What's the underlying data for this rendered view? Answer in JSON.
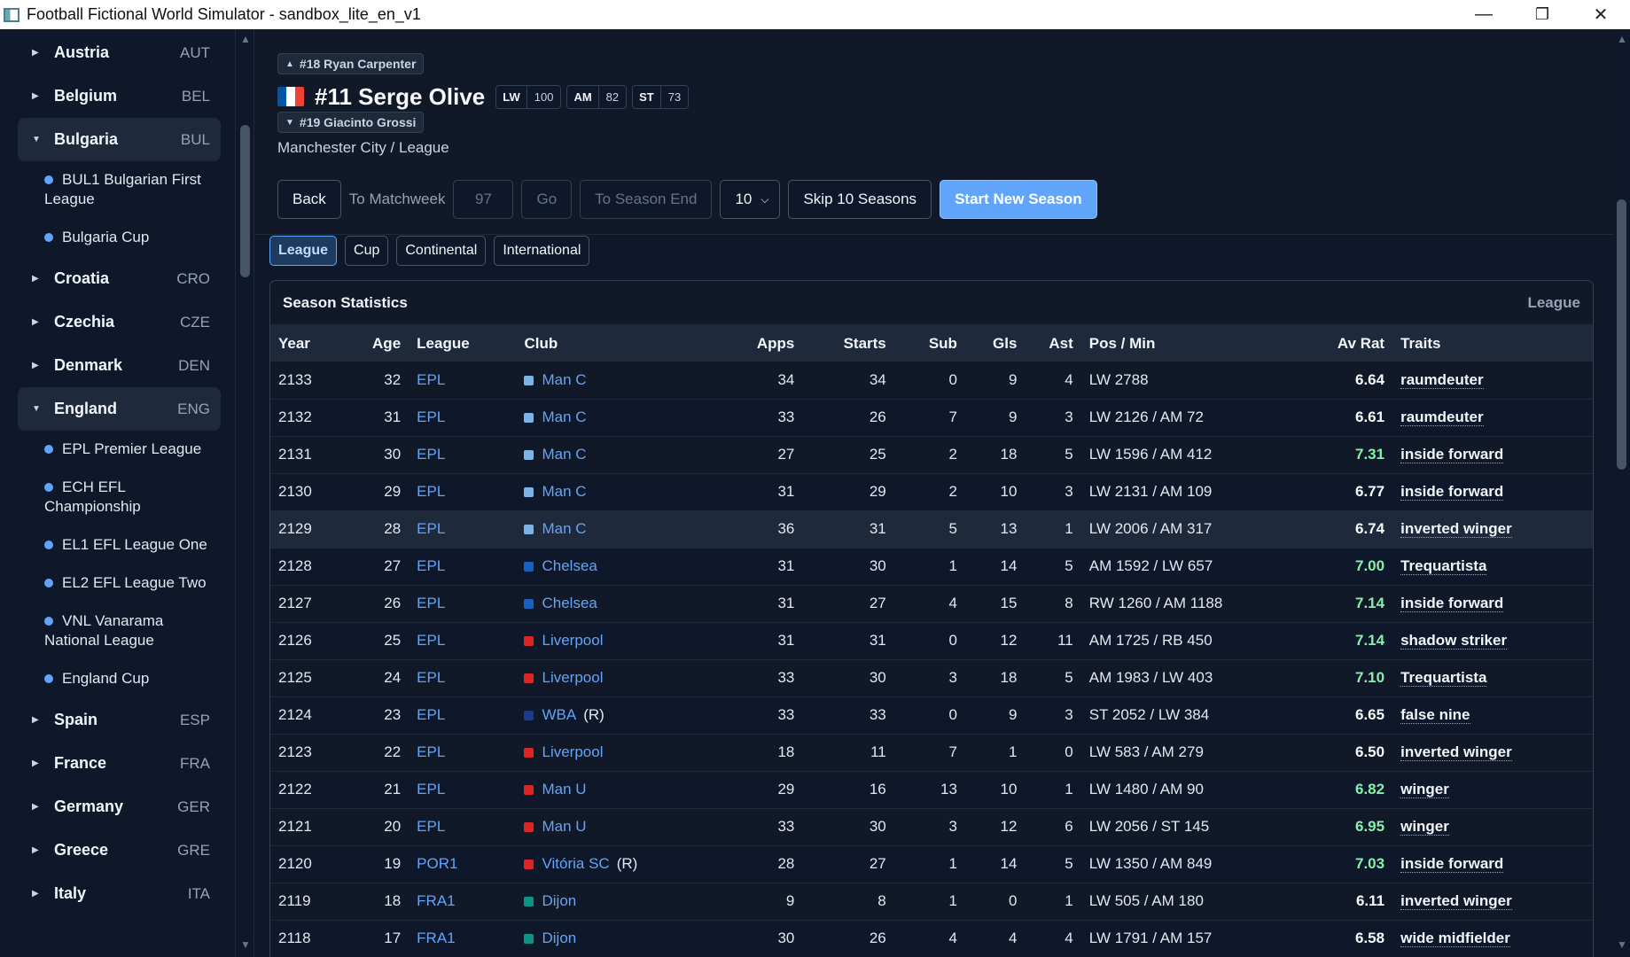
{
  "window": {
    "title": "Football Fictional World Simulator - sandbox_lite_en_v1",
    "minimize": "—",
    "maximize": "❐",
    "close": "✕"
  },
  "sidebar": {
    "items": [
      {
        "type": "country",
        "name": "Austria",
        "code": "AUT",
        "open": false
      },
      {
        "type": "country",
        "name": "Belgium",
        "code": "BEL",
        "open": false
      },
      {
        "type": "country",
        "name": "Bulgaria",
        "code": "BUL",
        "open": true
      },
      {
        "type": "comp",
        "name": "BUL1 Bulgarian First League"
      },
      {
        "type": "comp",
        "name": "Bulgaria Cup"
      },
      {
        "type": "country",
        "name": "Croatia",
        "code": "CRO",
        "open": false
      },
      {
        "type": "country",
        "name": "Czechia",
        "code": "CZE",
        "open": false
      },
      {
        "type": "country",
        "name": "Denmark",
        "code": "DEN",
        "open": false
      },
      {
        "type": "country",
        "name": "England",
        "code": "ENG",
        "open": true
      },
      {
        "type": "comp",
        "name": "EPL Premier League"
      },
      {
        "type": "comp",
        "name": "ECH EFL Championship"
      },
      {
        "type": "comp",
        "name": "EL1 EFL League One"
      },
      {
        "type": "comp",
        "name": "EL2 EFL League Two"
      },
      {
        "type": "comp",
        "name": "VNL Vanarama National League"
      },
      {
        "type": "comp",
        "name": "England Cup"
      },
      {
        "type": "country",
        "name": "Spain",
        "code": "ESP",
        "open": false
      },
      {
        "type": "country",
        "name": "France",
        "code": "FRA",
        "open": false
      },
      {
        "type": "country",
        "name": "Germany",
        "code": "GER",
        "open": false
      },
      {
        "type": "country",
        "name": "Greece",
        "code": "GRE",
        "open": false
      },
      {
        "type": "country",
        "name": "Italy",
        "code": "ITA",
        "open": false
      }
    ]
  },
  "player": {
    "prev": "#18 Ryan Carpenter",
    "next": "#19 Giacinto Grossi",
    "name": "#11 Serge Olive",
    "flag_colors": [
      "#0055A4",
      "#FFFFFF",
      "#EF4135"
    ],
    "positions": [
      {
        "pos": "LW",
        "val": "100"
      },
      {
        "pos": "AM",
        "val": "82"
      },
      {
        "pos": "ST",
        "val": "73"
      }
    ],
    "club_line": "Manchester City / League"
  },
  "controls": {
    "back": "Back",
    "to_matchweek_label": "To Matchweek",
    "matchweek_placeholder": "97",
    "go": "Go",
    "to_season_end": "To Season End",
    "skip_count": "10",
    "skip_button": "Skip 10 Seasons",
    "start_new_season": "Start New Season"
  },
  "tabs": [
    {
      "label": "League",
      "active": true
    },
    {
      "label": "Cup",
      "active": false
    },
    {
      "label": "Continental",
      "active": false
    },
    {
      "label": "International",
      "active": false
    }
  ],
  "stats": {
    "title": "Season Statistics",
    "scope": "League",
    "columns": [
      "Year",
      "Age",
      "League",
      "Club",
      "Apps",
      "Starts",
      "Sub",
      "Gls",
      "Ast",
      "Pos / Min",
      "Av Rat",
      "Traits"
    ],
    "rows": [
      {
        "year": "2133",
        "age": "32",
        "league": "EPL",
        "club": "Man C",
        "club_color": "#7db4e6",
        "rel": "",
        "apps": "34",
        "starts": "34",
        "sub": "0",
        "gls": "9",
        "ast": "4",
        "pos_min": "LW 2788",
        "rat": "6.64",
        "rat_color": "#f8fafc",
        "trait": "raumdeuter"
      },
      {
        "year": "2132",
        "age": "31",
        "league": "EPL",
        "club": "Man C",
        "club_color": "#7db4e6",
        "rel": "",
        "apps": "33",
        "starts": "26",
        "sub": "7",
        "gls": "9",
        "ast": "3",
        "pos_min": "LW 2126 / AM 72",
        "rat": "6.61",
        "rat_color": "#f8fafc",
        "trait": "raumdeuter"
      },
      {
        "year": "2131",
        "age": "30",
        "league": "EPL",
        "club": "Man C",
        "club_color": "#7db4e6",
        "rel": "",
        "apps": "27",
        "starts": "25",
        "sub": "2",
        "gls": "18",
        "ast": "5",
        "pos_min": "LW 1596 / AM 412",
        "rat": "7.31",
        "rat_color": "#86efac",
        "trait": "inside forward"
      },
      {
        "year": "2130",
        "age": "29",
        "league": "EPL",
        "club": "Man C",
        "club_color": "#7db4e6",
        "rel": "",
        "apps": "31",
        "starts": "29",
        "sub": "2",
        "gls": "10",
        "ast": "3",
        "pos_min": "LW 2131 / AM 109",
        "rat": "6.77",
        "rat_color": "#f8fafc",
        "trait": "inside forward"
      },
      {
        "year": "2129",
        "age": "28",
        "league": "EPL",
        "club": "Man C",
        "club_color": "#7db4e6",
        "rel": "",
        "apps": "36",
        "starts": "31",
        "sub": "5",
        "gls": "13",
        "ast": "1",
        "pos_min": "LW 2006 / AM 317",
        "rat": "6.74",
        "rat_color": "#f8fafc",
        "trait": "inverted winger"
      },
      {
        "year": "2128",
        "age": "27",
        "league": "EPL",
        "club": "Chelsea",
        "club_color": "#1d5fbf",
        "rel": "",
        "apps": "31",
        "starts": "30",
        "sub": "1",
        "gls": "14",
        "ast": "5",
        "pos_min": "AM 1592 / LW 657",
        "rat": "7.00",
        "rat_color": "#86efac",
        "trait": "Trequartista"
      },
      {
        "year": "2127",
        "age": "26",
        "league": "EPL",
        "club": "Chelsea",
        "club_color": "#1d5fbf",
        "rel": "",
        "apps": "31",
        "starts": "27",
        "sub": "4",
        "gls": "15",
        "ast": "8",
        "pos_min": "RW 1260 / AM 1188",
        "rat": "7.14",
        "rat_color": "#86efac",
        "trait": "inside forward"
      },
      {
        "year": "2126",
        "age": "25",
        "league": "EPL",
        "club": "Liverpool",
        "club_color": "#dc2626",
        "rel": "",
        "apps": "31",
        "starts": "31",
        "sub": "0",
        "gls": "12",
        "ast": "11",
        "pos_min": "AM 1725 / RB 450",
        "rat": "7.14",
        "rat_color": "#86efac",
        "trait": "shadow striker"
      },
      {
        "year": "2125",
        "age": "24",
        "league": "EPL",
        "club": "Liverpool",
        "club_color": "#dc2626",
        "rel": "",
        "apps": "33",
        "starts": "30",
        "sub": "3",
        "gls": "18",
        "ast": "5",
        "pos_min": "AM 1983 / LW 403",
        "rat": "7.10",
        "rat_color": "#86efac",
        "trait": "Trequartista"
      },
      {
        "year": "2124",
        "age": "23",
        "league": "EPL",
        "club": "WBA",
        "club_color": "#1e3a8a",
        "rel": "(R)",
        "apps": "33",
        "starts": "33",
        "sub": "0",
        "gls": "9",
        "ast": "3",
        "pos_min": "ST 2052 / LW 384",
        "rat": "6.65",
        "rat_color": "#f8fafc",
        "trait": "false nine"
      },
      {
        "year": "2123",
        "age": "22",
        "league": "EPL",
        "club": "Liverpool",
        "club_color": "#dc2626",
        "rel": "",
        "apps": "18",
        "starts": "11",
        "sub": "7",
        "gls": "1",
        "ast": "0",
        "pos_min": "LW 583 / AM 279",
        "rat": "6.50",
        "rat_color": "#f8fafc",
        "trait": "inverted winger"
      },
      {
        "year": "2122",
        "age": "21",
        "league": "EPL",
        "club": "Man U",
        "club_color": "#dc2626",
        "rel": "",
        "apps": "29",
        "starts": "16",
        "sub": "13",
        "gls": "10",
        "ast": "1",
        "pos_min": "LW 1480 / AM 90",
        "rat": "6.82",
        "rat_color": "#86efac",
        "trait": "winger"
      },
      {
        "year": "2121",
        "age": "20",
        "league": "EPL",
        "club": "Man U",
        "club_color": "#dc2626",
        "rel": "",
        "apps": "33",
        "starts": "30",
        "sub": "3",
        "gls": "12",
        "ast": "6",
        "pos_min": "LW 2056 / ST 145",
        "rat": "6.95",
        "rat_color": "#86efac",
        "trait": "winger"
      },
      {
        "year": "2120",
        "age": "19",
        "league": "POR1",
        "club": "Vitória SC",
        "club_color": "#dc2626",
        "rel": "(R)",
        "apps": "28",
        "starts": "27",
        "sub": "1",
        "gls": "14",
        "ast": "5",
        "pos_min": "LW 1350 / AM 849",
        "rat": "7.03",
        "rat_color": "#86efac",
        "trait": "inside forward"
      },
      {
        "year": "2119",
        "age": "18",
        "league": "FRA1",
        "club": "Dijon",
        "club_color": "#0d9488",
        "rel": "",
        "apps": "9",
        "starts": "8",
        "sub": "1",
        "gls": "0",
        "ast": "1",
        "pos_min": "LW 505 / AM 180",
        "rat": "6.11",
        "rat_color": "#f8fafc",
        "trait": "inverted winger"
      },
      {
        "year": "2118",
        "age": "17",
        "league": "FRA1",
        "club": "Dijon",
        "club_color": "#0d9488",
        "rel": "",
        "apps": "30",
        "starts": "26",
        "sub": "4",
        "gls": "4",
        "ast": "4",
        "pos_min": "LW 1791 / AM 157",
        "rat": "6.58",
        "rat_color": "#f8fafc",
        "trait": "wide midfielder"
      }
    ]
  }
}
